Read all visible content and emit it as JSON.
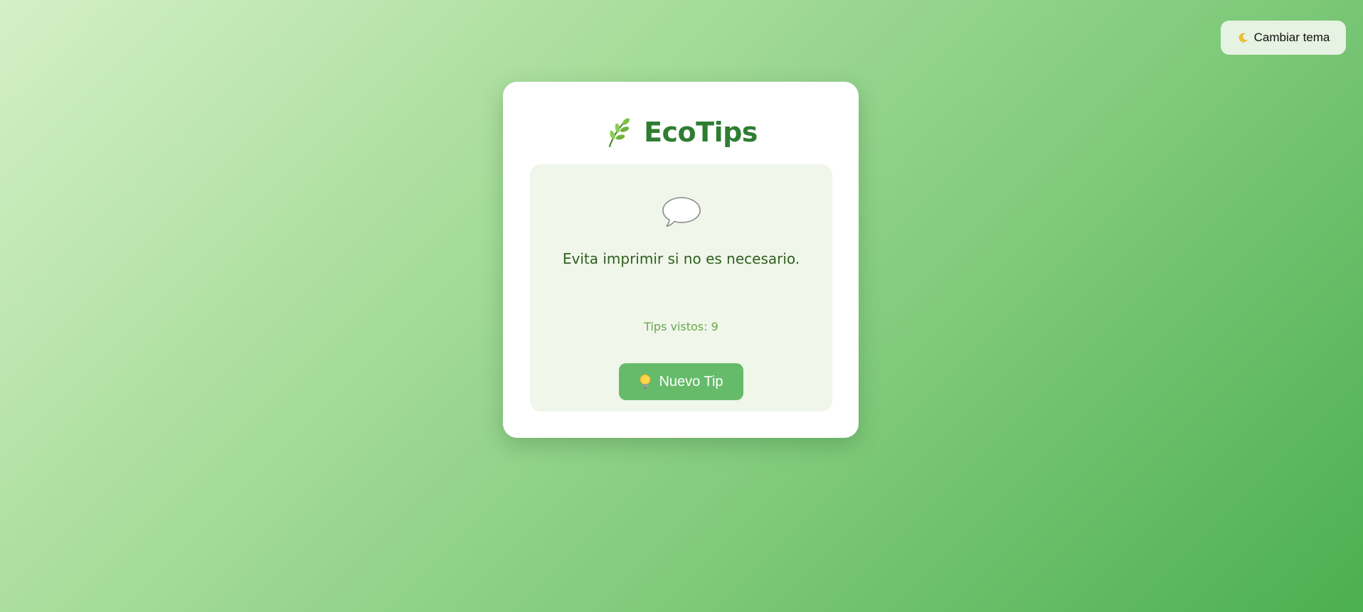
{
  "theme_toggle": {
    "icon": "moon-icon",
    "label": "Cambiar tema"
  },
  "app": {
    "title": "EcoTips",
    "title_icon": "leaf-icon",
    "accent_color": "#2e7d32",
    "button_color": "#66bb6a"
  },
  "tip": {
    "icon": "speech-bubble-icon",
    "text": "Evita imprimir si no es necesario."
  },
  "counter": {
    "label": "Tips vistos:",
    "value": "9"
  },
  "new_tip_button": {
    "icon": "lightbulb-icon",
    "label": "Nuevo Tip"
  }
}
